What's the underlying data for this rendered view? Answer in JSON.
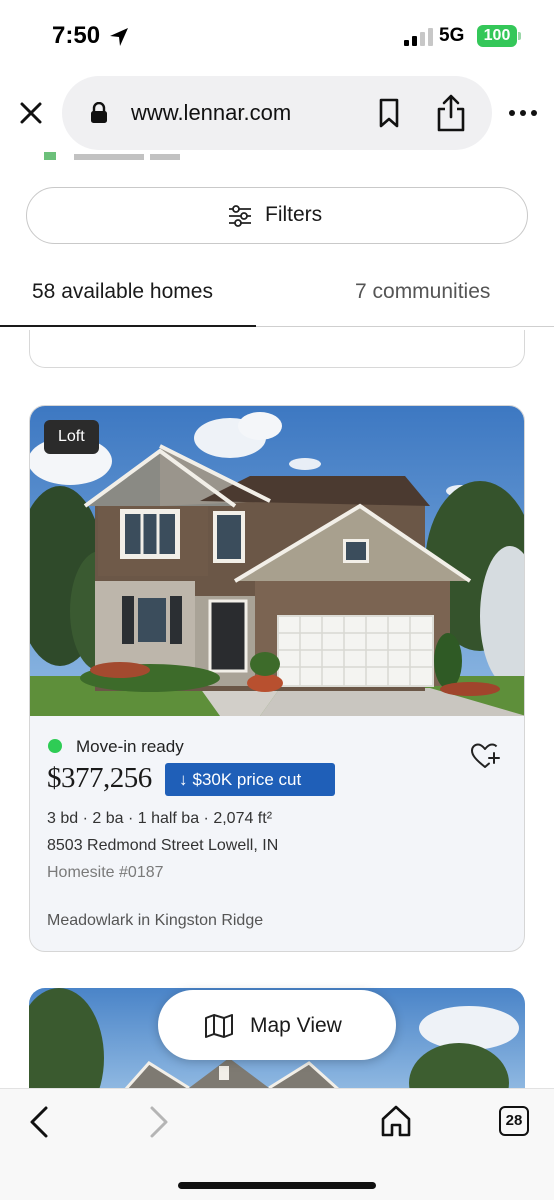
{
  "status_bar": {
    "time": "7:50",
    "network": "5G",
    "battery": "100",
    "icons": [
      "location-arrow-icon",
      "signal-icon",
      "battery-icon"
    ]
  },
  "browser": {
    "url": "www.lennar.com",
    "icons": [
      "close-icon",
      "lock-icon",
      "bookmark-icon",
      "share-icon",
      "more-icon"
    ]
  },
  "filters": {
    "label": "Filters",
    "icon": "sliders-icon"
  },
  "tabs": [
    {
      "label": "58 available homes",
      "active": true
    },
    {
      "label": "7 communities",
      "active": false
    }
  ],
  "listing": {
    "badge": "Loft",
    "status": "Move-in ready",
    "status_color": "#2ecc55",
    "price": "$377,256",
    "price_cut": "$30K price cut",
    "price_cut_color": "#1f5fb8",
    "specs": "3 bd · 2 ba · 1 half ba · 2,074 ft²",
    "address": "8503 Redmond Street Lowell, IN",
    "homesite": "Homesite #0187",
    "community": "Meadowlark in Kingston Ridge",
    "favorite_icon": "heart-plus-icon"
  },
  "map_button": {
    "label": "Map View",
    "icon": "map-icon"
  },
  "toolbar": {
    "tab_count": "28",
    "icons": [
      "back-arrow-icon",
      "forward-arrow-icon",
      "home-icon",
      "tabs-icon"
    ]
  }
}
